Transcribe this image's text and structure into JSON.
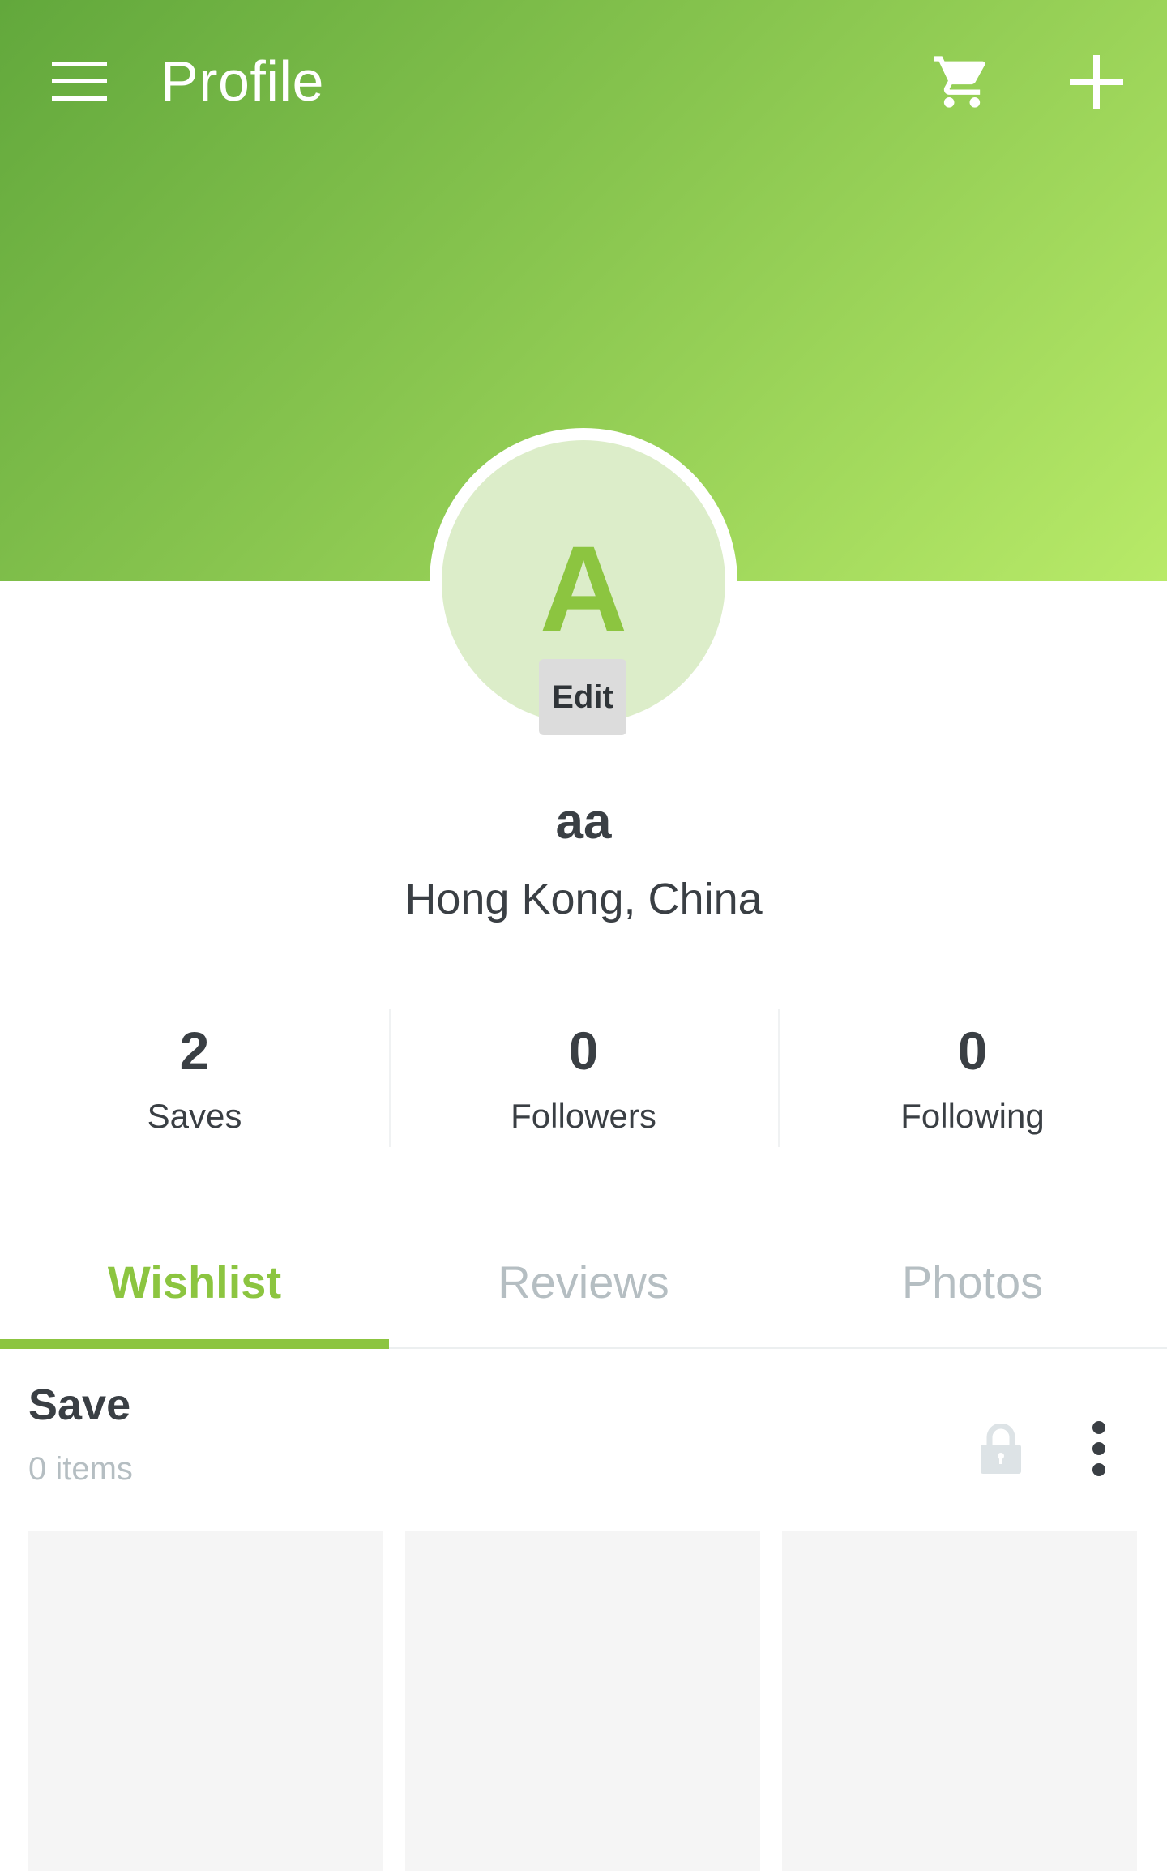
{
  "appbar": {
    "title": "Profile",
    "menu_icon": "hamburger-menu-icon",
    "cart_icon": "shopping-cart-icon",
    "add_icon": "plus-icon"
  },
  "theme": {
    "accent": "#8cc540",
    "header_gradient_start": "#62a83c",
    "header_gradient_end": "#b8ea68"
  },
  "profile": {
    "avatar_letter": "A",
    "edit_label": "Edit",
    "username": "aa",
    "location": "Hong Kong, China"
  },
  "stats": [
    {
      "value": "2",
      "label": "Saves"
    },
    {
      "value": "0",
      "label": "Followers"
    },
    {
      "value": "0",
      "label": "Following"
    }
  ],
  "tabs": [
    {
      "label": "Wishlist",
      "active": true
    },
    {
      "label": "Reviews",
      "active": false
    },
    {
      "label": "Photos",
      "active": false
    }
  ],
  "wishlist": {
    "title": "Save",
    "count": "0 items",
    "lock_icon": "lock-icon",
    "more_icon": "more-vertical-icon"
  }
}
